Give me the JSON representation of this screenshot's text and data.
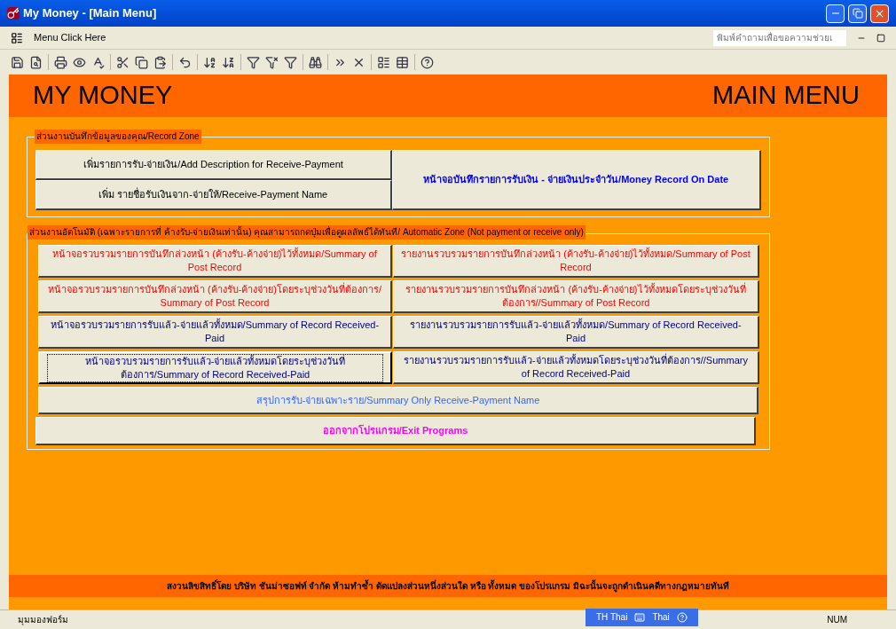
{
  "window": {
    "title": "My Money - [Main Menu]"
  },
  "menu_bar": {
    "label": "Menu Click Here",
    "help_field": {
      "placeholder": "พิมพ์คำถามเพื่อขอความช่วยเ"
    }
  },
  "header": {
    "app_name": "MY MONEY",
    "page_name": "MAIN MENU"
  },
  "record_zone": {
    "legend": "ส่วนงานบันทึกข้อมูลของคุณ/Record  Zone",
    "left_buttons": [
      {
        "label": "เพิ่มรายการรับ-จ่ายเงิน/Add Description for Receive-Payment",
        "color": "#000000"
      },
      {
        "label": "เพิ่ม รายชื่อรับเงินจาก-จ่ายให้/Receive-Payment Name",
        "color": "#000000"
      }
    ],
    "main_button": {
      "label": "หน้าจอบันทึกรายการรับเงิน - จ่ายเงินประจำวัน/Money Record On Date",
      "color": "#0000ff"
    }
  },
  "automatic_zone": {
    "legend": "ส่วนงานอัตโนมัติ  (เฉพาะรายการที่ ค้างรับ-จ่ายเงินเท่านั้น) คุณสามารถกดปุ่มเพื่อดูผลลัพธ์ได้ทันที/ Automatic Zone (Not payment or receive only)",
    "rows": [
      {
        "left": {
          "label": "หน้าจอรวบรวมรายการบันทึกล่วงหน้า (ค้างรับ-ค้างจ่าย)ไว้ทั้งหมด/Summary of Post Record",
          "color": "#ff0000",
          "focused": false
        },
        "right": {
          "label": "รายงานรวบรวมรายการบันทึกล่วงหน้า (ค้างรับ-ค้างจ่าย)ไว้ทั้งหมด/Summary of Post Record",
          "color": "#ff0000"
        }
      },
      {
        "left": {
          "label": "หน้าจอรวบรวมรายการบันทึกล่วงหน้า (ค้างรับ-ค้างจ่าย)โดยระบุช่วงวันที่ต้องการ/ Summary of Post Record",
          "color": "#ff0000",
          "focused": false
        },
        "right": {
          "label": "รายงานรวบรวมรายการบันทึกล่วงหน้า (ค้างรับ-ค้างจ่าย)ไว้ทั้งหมดโดยระบุช่วงวันที่ต้องการ//Summary of Post Record",
          "color": "#ff0000"
        }
      },
      {
        "left": {
          "label": "หน้าจอรวบรวมรายการรับแล้ว-จ่ายแล้วทั้งหมด/Summary of  Record Received-Paid",
          "color": "#000080",
          "focused": false
        },
        "right": {
          "label": "รายงานรวบรวมรายการรับแล้ว-จ่ายแล้วทั้งหมด/Summary of  Record Received-Paid",
          "color": "#000080"
        }
      },
      {
        "left": {
          "label": "หน้าจอรวบรวมรายการรับแล้ว-จ่ายแล้วทั้งหมดโดยระบุช่วงวันที่ต้องการ/Summary of Record Received-Paid",
          "color": "#000080",
          "focused": true
        },
        "right": {
          "label": "รายงานรวบรวมรายการรับแล้ว-จ่ายแล้วทั้งหมดโดยระบุช่วงวันที่ต้องการ//Summary of  Record Received-Paid",
          "color": "#000080"
        }
      }
    ],
    "summary_button": {
      "label": "สรุปการรับ-จ่ายเฉพาะราย/Summary Only Receive-Payment Name",
      "color": "#3366ff"
    },
    "exit_button": {
      "label": "ออกจากโปรแกรม/Exit Programs",
      "color": "#ff00ff"
    }
  },
  "footer": "สงวนลิขสิทธิ์โดย บริษัท ชันม่าซอฟท์  จำกัด ห้ามทำซ้ำ ดัดแปลงส่วนหนึ่งส่วนใด หรือ ทั้งหมด ของโปรแกรม มิฉะนั้นจะถูกดำเนินคดีทางกฎหมายทันที",
  "status_bar": {
    "view": "มุมมองฟอร์ม",
    "language": "TH Thai",
    "keyboard": "Thai",
    "num_lock": "NUM"
  }
}
